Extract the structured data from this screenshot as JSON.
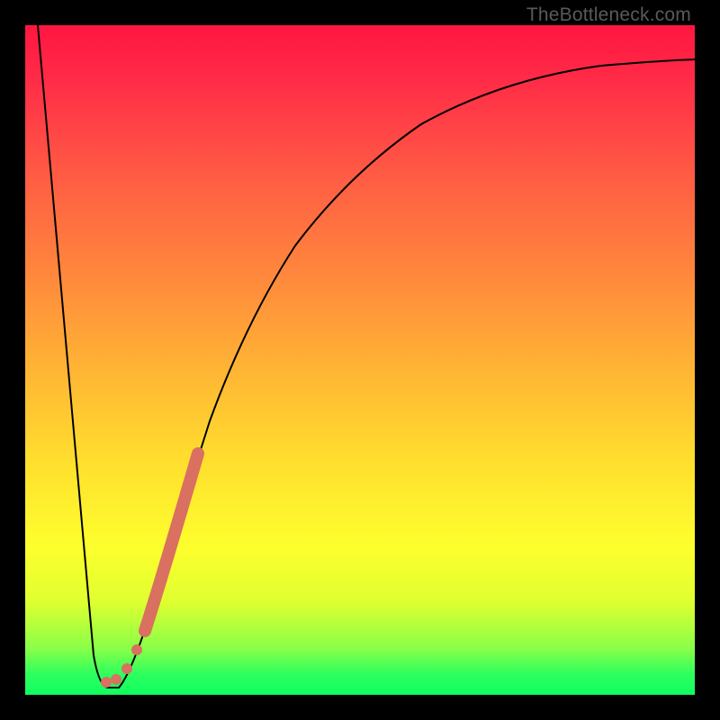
{
  "watermark": "TheBottleneck.com",
  "colors": {
    "frame": "#000000",
    "line": "#000000",
    "marker": "#d97060",
    "gradient_top": "#ff1640",
    "gradient_bottom": "#10ff60"
  },
  "chart_data": {
    "type": "line",
    "title": "",
    "xlabel": "",
    "ylabel": "",
    "xlim": [
      0,
      100
    ],
    "ylim": [
      0,
      100
    ],
    "x": [
      0,
      4,
      8,
      10,
      12,
      14,
      16,
      18,
      20,
      22,
      24,
      26,
      28,
      30,
      34,
      38,
      42,
      48,
      55,
      62,
      70,
      80,
      90,
      100
    ],
    "y": [
      100,
      62,
      25,
      6,
      2,
      2,
      5,
      12,
      20,
      28,
      36,
      43,
      50,
      56,
      63,
      69,
      74,
      79,
      83,
      86,
      89,
      91,
      92.5,
      93.5
    ],
    "markers": {
      "segment": {
        "x": [
          17.5,
          24.0
        ],
        "y": [
          10,
          37
        ]
      },
      "dots": [
        {
          "x": 11.4,
          "y": 2.2
        },
        {
          "x": 13.0,
          "y": 3.0
        },
        {
          "x": 14.8,
          "y": 4.5
        },
        {
          "x": 16.2,
          "y": 7.5
        }
      ]
    }
  }
}
